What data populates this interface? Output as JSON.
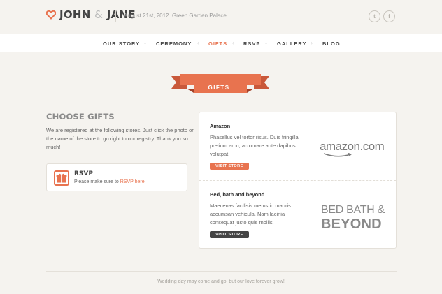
{
  "header": {
    "logo_name": "JOHN",
    "logo_amp": "&",
    "logo_name2": "JANE",
    "tagline": "August 21st, 2012. Green Garden Palace.",
    "social": [
      {
        "icon": "twitter-icon",
        "glyph": "t"
      },
      {
        "icon": "facebook-icon",
        "glyph": "f"
      }
    ]
  },
  "nav": {
    "items": [
      {
        "label": "OUR STORY"
      },
      {
        "label": "CEREMONY"
      },
      {
        "label": "GIFTS"
      },
      {
        "label": "RSVP"
      },
      {
        "label": "GALLERY"
      },
      {
        "label": "BLOG"
      }
    ],
    "active": "GIFTS",
    "separator": "✧"
  },
  "ribbon": {
    "label": "GIFTS"
  },
  "left": {
    "title": "CHOOSE GIFTS",
    "intro": "We are registered at the following stores. Just click the photo or the name of the store to go right to our registry. Thank you so much!",
    "rsvp": {
      "title": "RSVP",
      "text": "Please make sure to ",
      "link": "RSVP here",
      "text_end": "."
    }
  },
  "stores": [
    {
      "name": "Amazon",
      "description": "Phasellus vel tortor risus. Duis fringilla pretium arcu, ac ornare ante dapibus volutpat.",
      "button": "VISIT STORE",
      "logo": "amazon.com"
    },
    {
      "name": "Bed, bath and beyond",
      "description": "Maecenas facilisis metus id mauris accumsan vehicula. Nam lacinia consequat justo quis mollis.",
      "button": "VISIT STORE",
      "logo_line1": "BED BATH &",
      "logo_line2": "BEYOND"
    }
  ],
  "footer": {
    "text": "Wedding day may come and go, but our love forever grow!"
  },
  "colors": {
    "accent": "#e8734f",
    "dark_button": "#444444",
    "background": "#f5f3ef"
  }
}
